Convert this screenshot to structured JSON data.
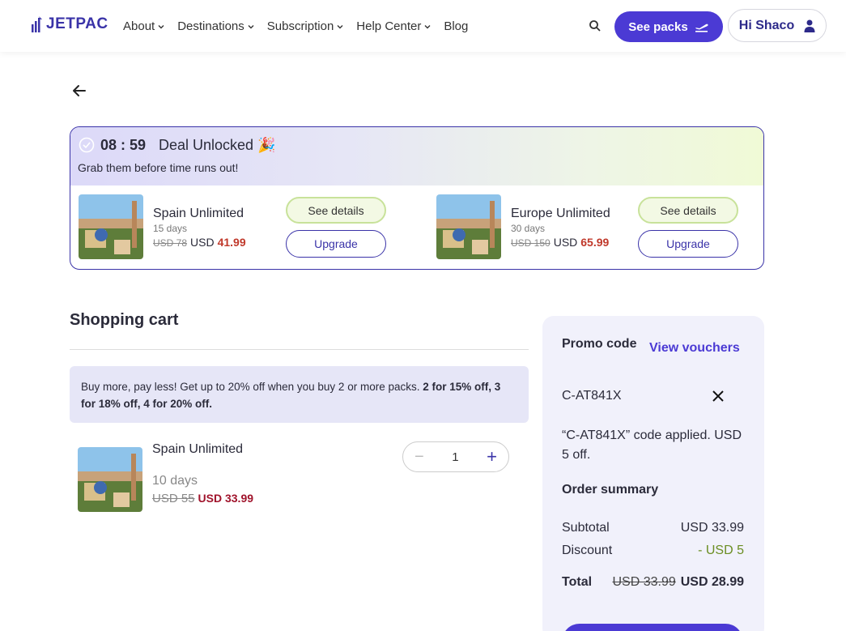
{
  "header": {
    "logo": "JETPAC",
    "nav": [
      {
        "label": "About",
        "dropdown": true
      },
      {
        "label": "Destinations",
        "dropdown": true
      },
      {
        "label": "Subscription",
        "dropdown": true
      },
      {
        "label": "Help Center",
        "dropdown": true
      },
      {
        "label": "Blog",
        "dropdown": false
      }
    ],
    "see_packs": "See packs",
    "user_greeting": "Hi Shaco"
  },
  "deal": {
    "timer": "08 : 59",
    "title": "Deal Unlocked 🎉",
    "subtitle": "Grab them before time runs out!",
    "cards": [
      {
        "name": "Spain Unlimited",
        "days": "15 days",
        "old_price": "USD 78",
        "currency": "USD",
        "price": "41.99",
        "details_label": "See details",
        "upgrade_label": "Upgrade"
      },
      {
        "name": "Europe Unlimited",
        "days": "30 days",
        "old_price": "USD 150",
        "currency": "USD",
        "price": "65.99",
        "details_label": "See details",
        "upgrade_label": "Upgrade"
      }
    ]
  },
  "cart": {
    "title": "Shopping cart",
    "banner_text": "Buy more, pay less! Get up to 20% off when you buy 2 or more packs. ",
    "banner_bold": "2 for 15% off, 3 for 18% off, 4 for 20% off.",
    "item": {
      "name": "Spain Unlimited",
      "days": "10 days",
      "old_price": "USD 55",
      "new_price": "USD 33.99",
      "quantity": "1"
    }
  },
  "summary": {
    "promo_label": "Promo code",
    "view_vouchers": "View vouchers",
    "promo_code": "C-AT841X",
    "applied_text": "“C-AT841X” code applied. USD 5 off.",
    "order_summary": "Order summary",
    "subtotal_label": "Subtotal",
    "subtotal_value": "USD 33.99",
    "discount_label": "Discount",
    "discount_value": "- USD 5",
    "total_label": "Total",
    "total_old": "USD 33.99",
    "total_new": "USD 28.99"
  },
  "colors": {
    "brand": "#4b3ad4",
    "price_red": "#c0392b",
    "discount_green": "#6b8e23"
  }
}
